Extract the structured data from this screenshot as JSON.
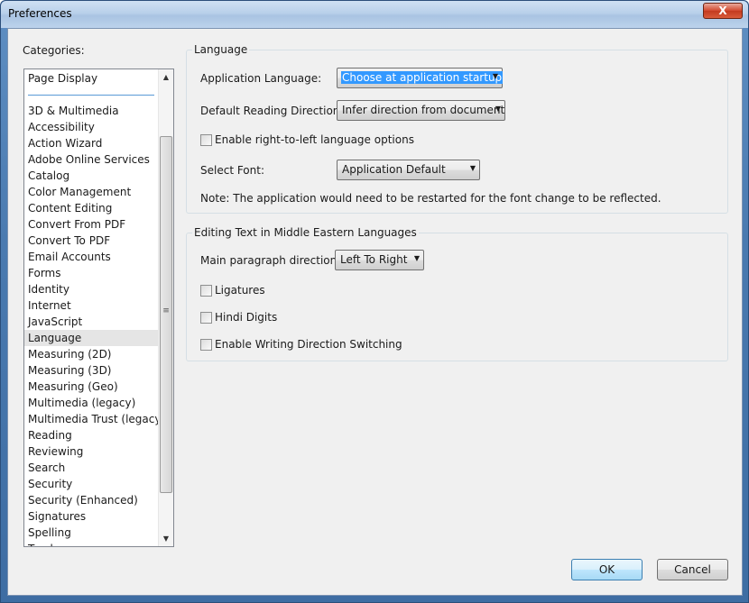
{
  "window": {
    "title": "Preferences",
    "close_symbol": "X"
  },
  "categories": {
    "label": "Categories:",
    "top_item": "Page Display",
    "items": [
      "3D & Multimedia",
      "Accessibility",
      "Action Wizard",
      "Adobe Online Services",
      "Catalog",
      "Color Management",
      "Content Editing",
      "Convert From PDF",
      "Convert To PDF",
      "Email Accounts",
      "Forms",
      "Identity",
      "Internet",
      "JavaScript",
      "Language",
      "Measuring (2D)",
      "Measuring (3D)",
      "Measuring (Geo)",
      "Multimedia (legacy)",
      "Multimedia Trust (legacy)",
      "Reading",
      "Reviewing",
      "Search",
      "Security",
      "Security (Enhanced)",
      "Signatures",
      "Spelling",
      "Tracker"
    ],
    "selected": "Language"
  },
  "language_group": {
    "legend": "Language",
    "app_language_label": "Application Language:",
    "app_language_value": "Choose at application startup",
    "reading_direction_label": "Default Reading Direction:",
    "reading_direction_value": "Infer direction from document",
    "rtl_options_label": "Enable right-to-left language options",
    "rtl_options_checked": false,
    "select_font_label": "Select Font:",
    "select_font_value": "Application Default",
    "note": "Note: The application would need to be restarted for the font change to be reflected."
  },
  "middle_east_group": {
    "legend": "Editing Text in Middle Eastern Languages",
    "paragraph_direction_label": "Main paragraph direction:",
    "paragraph_direction_value": "Left To Right",
    "ligatures_label": "Ligatures",
    "ligatures_checked": false,
    "hindi_digits_label": "Hindi Digits",
    "hindi_digits_checked": false,
    "writing_direction_label": "Enable Writing Direction Switching",
    "writing_direction_checked": false
  },
  "buttons": {
    "ok": "OK",
    "cancel": "Cancel"
  }
}
